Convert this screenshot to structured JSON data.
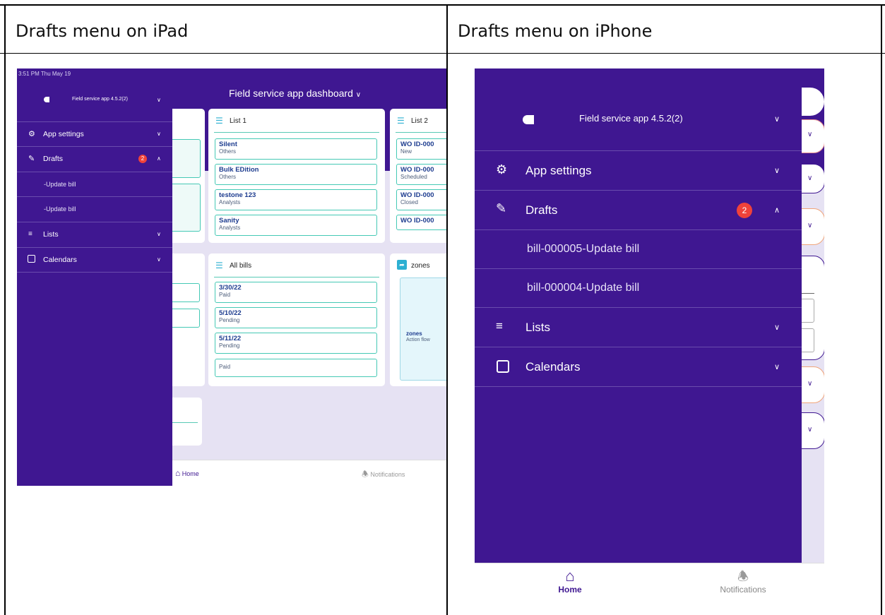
{
  "headers": {
    "left": "Drafts menu on iPad",
    "right": "Drafts menu on iPhone"
  },
  "ipad": {
    "status_time": "3:51 PM  Thu May 19",
    "app_name": "Field service app 4.5.2(2)",
    "dashboard_title": "Field service app dashboard",
    "menu": {
      "app_settings": "App settings",
      "drafts": "Drafts",
      "drafts_badge": "2",
      "draft_items": [
        "-Update bill",
        "-Update bill"
      ],
      "lists": "Lists",
      "calendars": "Calendars"
    },
    "list1": {
      "title": "List 1",
      "items": [
        {
          "title": "Silent",
          "sub": "Others"
        },
        {
          "title": "Bulk EDition",
          "sub": "Others"
        },
        {
          "title": "testone 123",
          "sub": "Analysts"
        },
        {
          "title": "Sanity",
          "sub": "Analysts"
        }
      ]
    },
    "list2": {
      "title": "List 2",
      "items": [
        {
          "title": "WO ID-000",
          "sub": "New"
        },
        {
          "title": "WO ID-000",
          "sub": "Scheduled"
        },
        {
          "title": "WO ID-000",
          "sub": "Closed"
        },
        {
          "title": "WO ID-000",
          "sub": ""
        }
      ]
    },
    "all_bills": {
      "title": "All bills",
      "items": [
        {
          "title": "3/30/22",
          "sub": "Paid"
        },
        {
          "title": "5/10/22",
          "sub": "Pending"
        },
        {
          "title": "5/11/22",
          "sub": "Pending"
        },
        {
          "title": "",
          "sub": "Paid"
        }
      ]
    },
    "zones": {
      "title": "zones",
      "inner_title": "zones",
      "inner_sub": "Action flow"
    },
    "nav": {
      "home": "Home",
      "notifications": "Notifications"
    }
  },
  "iphone": {
    "app_name": "Field service app 4.5.2(2)",
    "menu": {
      "app_settings": "App settings",
      "drafts": "Drafts",
      "drafts_badge": "2",
      "draft_items": [
        "bill-000005-Update bill",
        "bill-000004-Update bill"
      ],
      "lists": "Lists",
      "calendars": "Calendars"
    },
    "nav": {
      "home": "Home",
      "notifications": "Notifications"
    }
  },
  "colors": {
    "brand_purple": "#3f1791",
    "lavender_bg": "#e6e2f3",
    "badge_red": "#f0423a",
    "teal_border": "#45c9b5"
  }
}
